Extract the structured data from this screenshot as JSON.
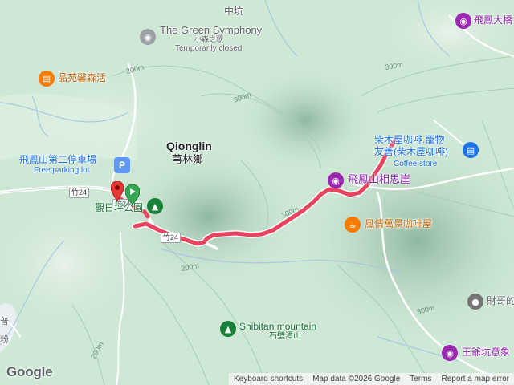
{
  "map": {
    "labels": {
      "zhongkeng": "中坑",
      "green_symphony_en": "The Green Symphony",
      "green_symphony_zh": "小森之歌",
      "green_symphony_status": "Temporarily closed",
      "pinyuan": "品苑馨森活",
      "feifeng_big": "飛鳳大橋",
      "parking_zh": "飛鳳山第二停車場",
      "parking_en": "Free parking lot",
      "qionglin_en": "Qionglin",
      "qionglin_zh": "芎林鄉",
      "chaimuwu_line1": "柴木屋咖啡.寵物",
      "chaimuwu_line2": "友善(柴木屋咖啡)",
      "coffee_store": "Coffee store",
      "xiangsiya": "飛鳳山相思崖",
      "fengqing": "風情萬景咖啡屋",
      "guanri": "觀日坪公園",
      "shibitan_en": "Shibitan mountain",
      "shibitan_zh": "石壁潭山",
      "caige": "財哥的",
      "wangyekeng": "王爺坑意象",
      "left_edge_1": "普",
      "left_edge_2": "粉"
    },
    "contours": [
      "200m",
      "300m",
      "300m",
      "300m",
      "200m",
      "300m",
      "200m"
    ],
    "road_shields": [
      "竹24",
      "竹24",
      "竹24"
    ],
    "icons": {
      "route_start": "green-flag-marker-icon",
      "route_end": "red-pin-marker-icon",
      "park": "park-tree-icon",
      "parking": "parking-icon",
      "camera": "camera-icon",
      "cafe": "coffee-cup-icon",
      "shopping": "shopping-bag-icon",
      "location": "location-pin-icon"
    },
    "colors": {
      "route": "#e8445f",
      "purple_poi": "#9c27b0",
      "orange_poi": "#f57c00",
      "blue_poi": "#1a73e8",
      "green_poi": "#188038"
    }
  },
  "attribution": {
    "logo": "Google",
    "keyboard": "Keyboard shortcuts",
    "data": "Map data ©2026 Google",
    "terms": "Terms",
    "report": "Report a map error"
  }
}
